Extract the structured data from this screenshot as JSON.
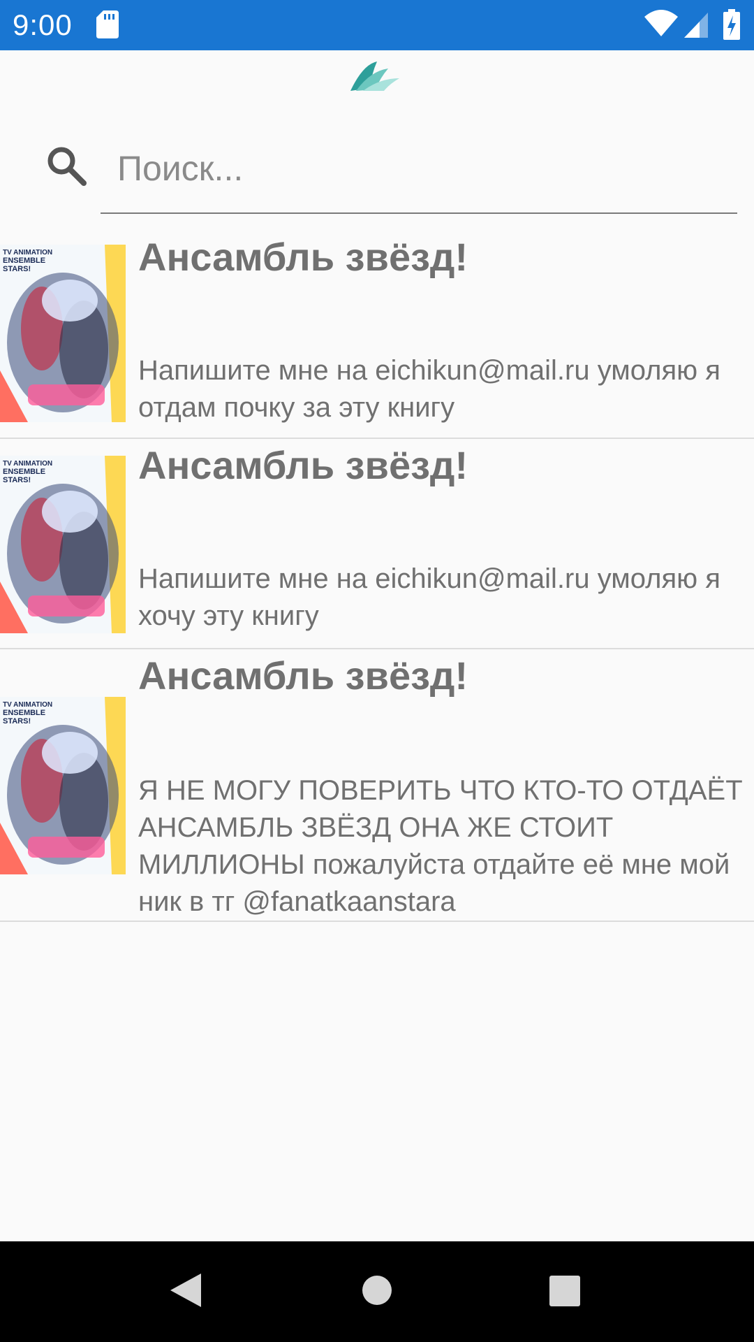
{
  "status_bar": {
    "time": "9:00",
    "icons": [
      "sd-card-icon",
      "wifi-icon",
      "cell-signal-icon",
      "battery-charging-icon"
    ],
    "background_color": "#1976d2"
  },
  "header": {
    "logo": "book-logo-icon",
    "logo_colors": [
      "#2e9f9a",
      "#8fd6cf"
    ]
  },
  "search": {
    "icon": "search-icon",
    "placeholder": "Поиск...",
    "value": ""
  },
  "items": [
    {
      "title": "Ансамбль звёзд!",
      "description": "Напишите мне на eichikun@mail.ru умоляю я отдам почку за эту книгу",
      "cover": "ensemble-stars-cover"
    },
    {
      "title": "Ансамбль звёзд!",
      "description": "Напишите мне на eichikun@mail.ru умоляю я хочу эту книгу",
      "cover": "ensemble-stars-cover"
    },
    {
      "title": "Ансамбль звёзд!",
      "description": "Я НЕ МОГУ ПОВЕРИТЬ ЧТО КТО-ТО ОТДАЁТ АНСАМБЛЬ ЗВЁЗД ОНА ЖЕ СТОИТ МИЛЛИОНЫ пожалуйста отдайте её мне мой ник в тг @fanatkaanstara",
      "cover": "ensemble-stars-cover"
    }
  ],
  "cover_art": {
    "lines": [
      "TV ANIMATION",
      "ENSEMBLE",
      "STARS!"
    ]
  },
  "nav_bar": {
    "buttons": [
      "back-icon",
      "home-icon",
      "recents-icon"
    ]
  }
}
